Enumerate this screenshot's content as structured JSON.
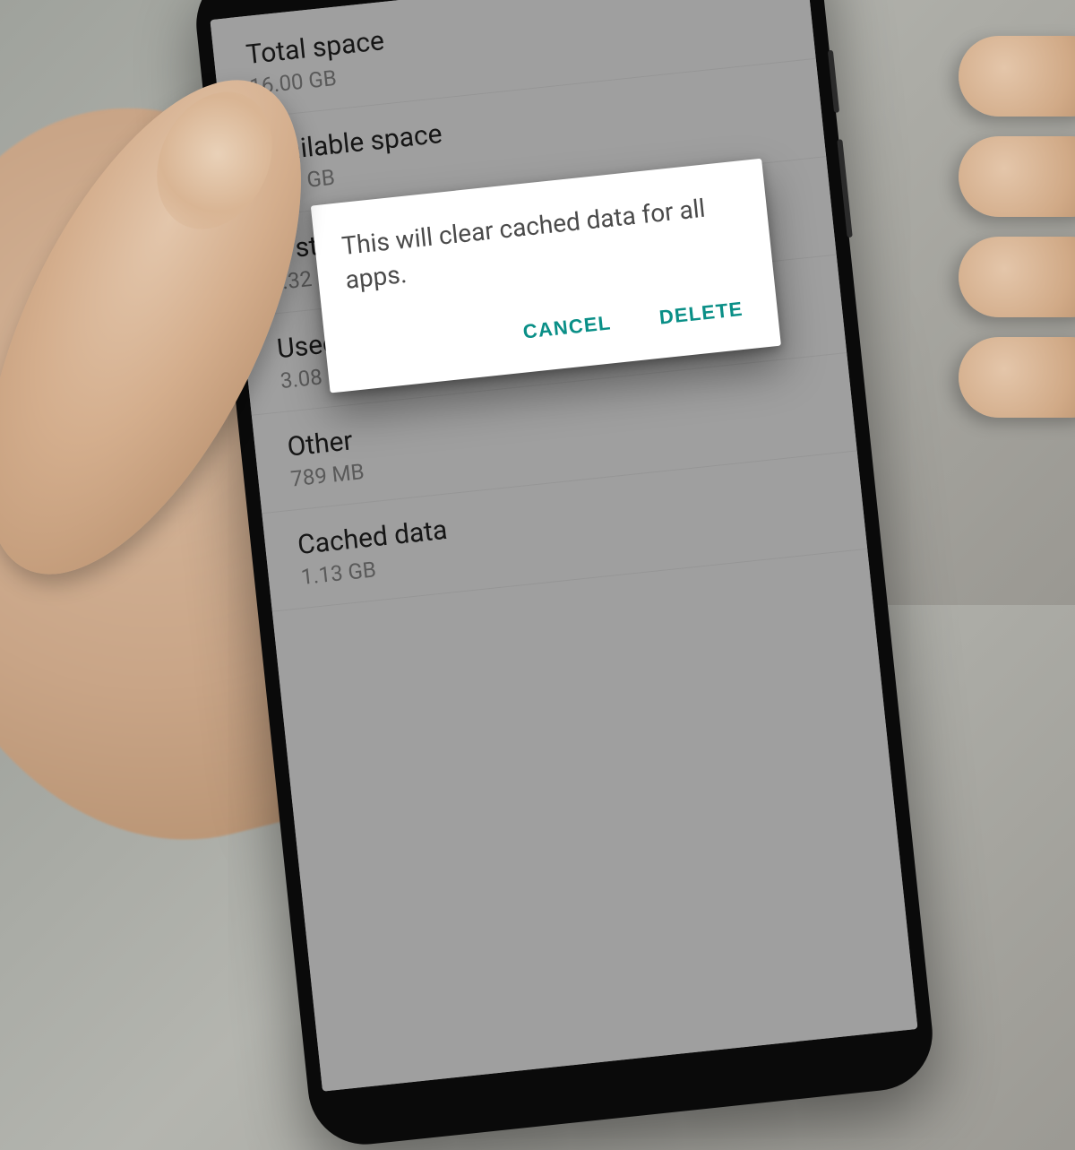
{
  "storage": {
    "rows": [
      {
        "title": "Total space",
        "value": "16.00 GB"
      },
      {
        "title": "Available space",
        "value": "5.97 GB"
      },
      {
        "title": "System memory",
        "value": "4.32 GB"
      },
      {
        "title": "Used space",
        "value": "3.08 GB"
      },
      {
        "title": "Other",
        "value": "789 MB"
      },
      {
        "title": "Cached data",
        "value": "1.13 GB"
      }
    ]
  },
  "dialog": {
    "message": "This will clear cached data for all apps.",
    "cancel_label": "CANCEL",
    "confirm_label": "DELETE"
  },
  "colors": {
    "accent": "#0a8f87"
  }
}
